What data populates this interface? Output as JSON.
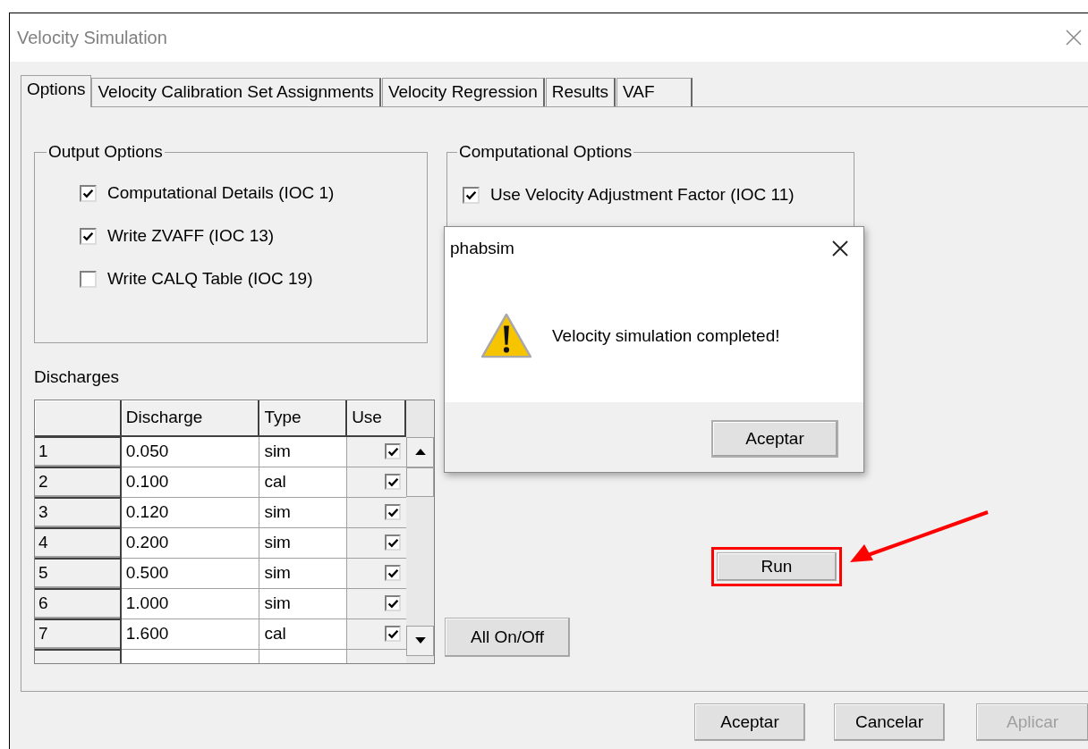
{
  "window": {
    "title": "Velocity Simulation"
  },
  "tabs": [
    {
      "label": "Options",
      "selected": true
    },
    {
      "label": "Velocity Calibration Set Assignments",
      "selected": false
    },
    {
      "label": "Velocity Regression",
      "selected": false
    },
    {
      "label": "Results",
      "selected": false
    },
    {
      "label": "VAF",
      "selected": false
    }
  ],
  "output_options": {
    "title": "Output Options",
    "options": [
      {
        "label": "Computational Details (IOC 1)",
        "checked": true
      },
      {
        "label": "Write ZVAFF (IOC 13)",
        "checked": true
      },
      {
        "label": "Write CALQ Table (IOC 19)",
        "checked": false
      }
    ]
  },
  "computational_options": {
    "title": "Computational Options",
    "options": [
      {
        "label": "Use Velocity Adjustment Factor (IOC 11)",
        "checked": true
      }
    ]
  },
  "discharges": {
    "title": "Discharges",
    "columns": [
      "Discharge",
      "Type",
      "Use"
    ],
    "rows": [
      {
        "number": "1",
        "discharge": "0.050",
        "type": "sim",
        "use": true
      },
      {
        "number": "2",
        "discharge": "0.100",
        "type": "cal",
        "use": true
      },
      {
        "number": "3",
        "discharge": "0.120",
        "type": "sim",
        "use": true
      },
      {
        "number": "4",
        "discharge": "0.200",
        "type": "sim",
        "use": true
      },
      {
        "number": "5",
        "discharge": "0.500",
        "type": "sim",
        "use": true
      },
      {
        "number": "6",
        "discharge": "1.000",
        "type": "sim",
        "use": true
      },
      {
        "number": "7",
        "discharge": "1.600",
        "type": "cal",
        "use": true
      }
    ]
  },
  "run_button": {
    "label": "Run",
    "highlighted": true
  },
  "all_button": {
    "label": "All On/Off"
  },
  "dialog_buttons": [
    {
      "label": "Aceptar",
      "disabled": false
    },
    {
      "label": "Cancelar",
      "disabled": false
    },
    {
      "label": "Aplicar",
      "disabled": true
    }
  ],
  "message_box": {
    "title": "phabsim",
    "message": "Velocity simulation completed!",
    "button": "Aceptar"
  }
}
